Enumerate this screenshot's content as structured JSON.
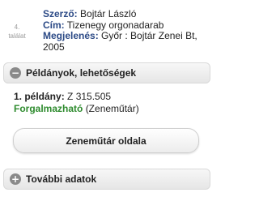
{
  "result": {
    "number": "4.",
    "number_suffix": "találat",
    "author_label": "Szerző:",
    "author": "Bojtár László",
    "title_label": "Cím:",
    "title": "Tizenegy orgonadarab",
    "publication_label": "Megjelenés:",
    "publication": "Győr : Bojtár Zenei Bt, 2005"
  },
  "copies_section": {
    "title": "Példányok, lehetőségek",
    "icon": "minus-icon",
    "expanded": true
  },
  "copies": [
    {
      "label": "1. példány:",
      "call_number": "Z 315.505",
      "status": "Forgalmazható",
      "status_note": "(Zeneműtár)",
      "status_color": "#2e8b2e"
    }
  ],
  "actions": {
    "library_page_button": "Zeneműtár oldala"
  },
  "more_section": {
    "title": "További adatok",
    "icon": "plus-icon",
    "expanded": false
  },
  "colors": {
    "label_blue": "#2c4a86",
    "available_green": "#2e8b2e"
  }
}
